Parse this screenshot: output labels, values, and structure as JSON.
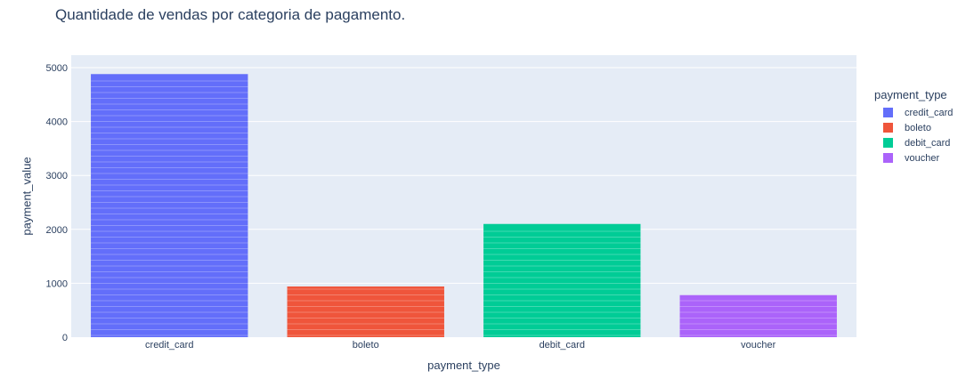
{
  "chart_data": {
    "type": "bar",
    "title": "Quantidade de vendas por categoria de pagamento.",
    "xlabel": "payment_type",
    "ylabel": "payment_value",
    "categories": [
      "credit_card",
      "boleto",
      "debit_card",
      "voucher"
    ],
    "values": [
      4880,
      940,
      2100,
      780
    ],
    "ylim": [
      0,
      5000
    ],
    "yticks": [
      0,
      1000,
      2000,
      3000,
      4000,
      5000
    ],
    "grid": true,
    "legend": {
      "title": "payment_type",
      "placement": "right",
      "entries": [
        "credit_card",
        "boleto",
        "debit_card",
        "voucher"
      ]
    },
    "colors": {
      "credit_card": "#636efa",
      "boleto": "#ef553b",
      "debit_card": "#00cc96",
      "voucher": "#ab63fa"
    },
    "plot_background": "#e5ecf6"
  }
}
